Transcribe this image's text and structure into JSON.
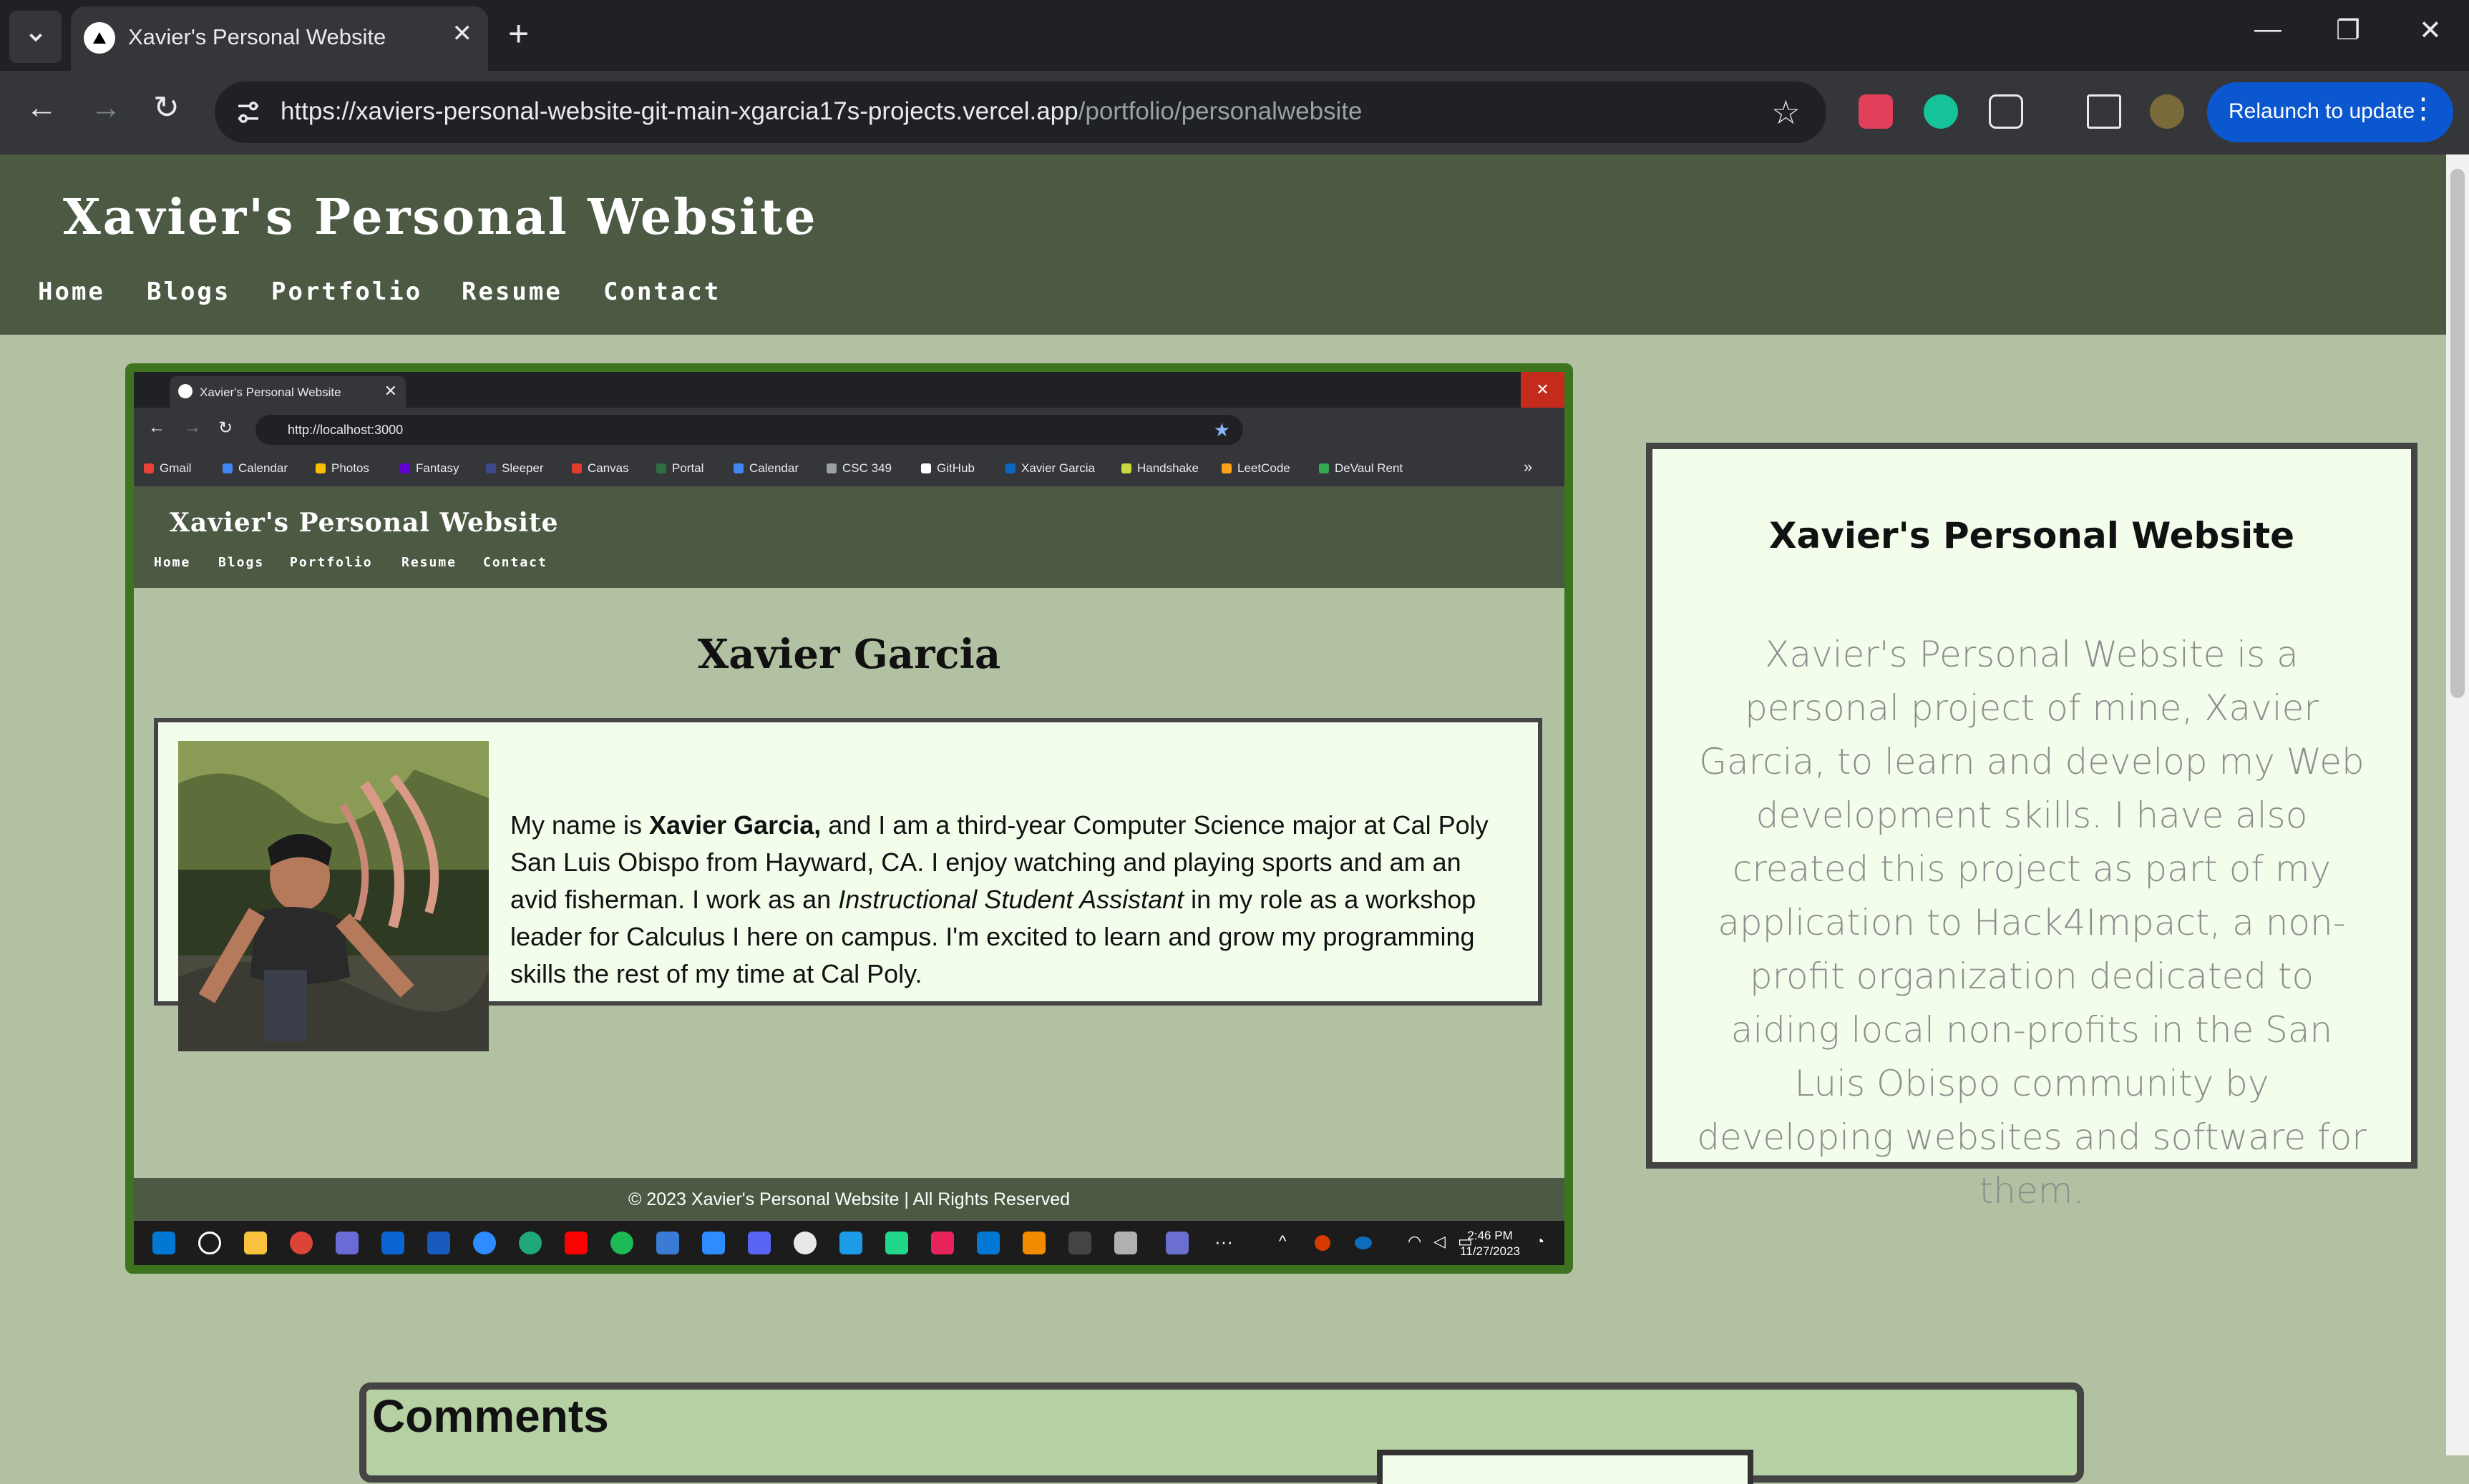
{
  "browser": {
    "tab_title": "Xavier's Personal Website",
    "url_host": "https://xaviers-personal-website-git-main-xgarcia17s-projects.vercel.app",
    "url_path": "/portfolio/personalwebsite",
    "relaunch_label": "Relaunch to update"
  },
  "site": {
    "title": "Xavier's Personal Website",
    "nav": [
      "Home",
      "Blogs",
      "Portfolio",
      "Resume",
      "Contact"
    ]
  },
  "screenshot": {
    "tab_title": "Xavier's Personal Website",
    "url": "http://localhost:3000",
    "bookmarks": [
      "Gmail",
      "Calendar",
      "Photos",
      "Fantasy",
      "Sleeper",
      "Canvas",
      "Portal",
      "Calendar",
      "CSC 349",
      "GitHub",
      "Xavier Garcia",
      "Handshake",
      "LeetCode",
      "DeVaul Rent"
    ],
    "site_title": "Xavier's Personal Website",
    "nav": [
      "Home",
      "Blogs",
      "Portfolio",
      "Resume",
      "Contact"
    ],
    "heading": "Xavier Garcia",
    "bio_pre": "My name is ",
    "bio_name": "Xavier Garcia,",
    "bio_mid": " and I am a third-year Computer Science major at Cal Poly San Luis Obispo from Hayward, CA. I enjoy watching and playing sports and am an avid fisherman. I work as an ",
    "bio_role": "Instructional Student Assistant",
    "bio_post": " in my role as a workshop leader for Calculus I here on campus. I'm excited to learn and grow my programming skills the rest of my time at Cal Poly.",
    "footer": "© 2023 Xavier's Personal Website | All Rights Reserved",
    "clock_time": "2:46 PM",
    "clock_date": "11/27/2023"
  },
  "info_card": {
    "title": "Xavier's Personal Website",
    "description": "Xavier's Personal Website is a personal project of mine, Xavier Garcia, to learn and develop my Web development skills. I have also created this project as part of my application to Hack4Impact, a non-profit organization dedicated to aiding local non-profits in the San Luis Obispo community by developing websites and software for them."
  },
  "comments": {
    "heading": "Comments"
  },
  "colors": {
    "header": "#4c5a44",
    "page_bg": "#b1c1a1",
    "card_bg": "#f2fdeb",
    "screenshot_border": "#3e7420",
    "accent": "#0b57d0"
  }
}
